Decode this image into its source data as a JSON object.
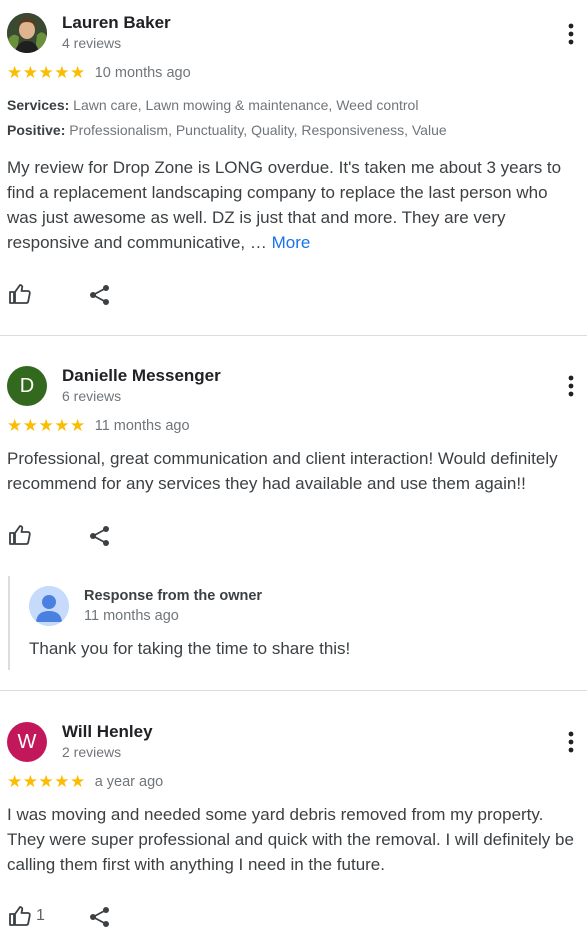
{
  "reviews": [
    {
      "name": "Lauren Baker",
      "reviews_count": "4 reviews",
      "stars": "★★★★★",
      "time": "10 months ago",
      "services_label": "Services:",
      "services": "Lawn care, Lawn mowing & maintenance, Weed control",
      "positive_label": "Positive:",
      "positive": "Professionalism, Punctuality, Quality, Responsiveness, Value",
      "text": "My review for Drop Zone is LONG overdue. It's taken me about 3 years to find a replacement landscaping company to replace the last person who was just awesome as well. DZ is just that and more. They are very responsive and communicative, …",
      "more_label": "More"
    },
    {
      "name": "Danielle Messenger",
      "avatar_letter": "D",
      "avatar_color": "#33691e",
      "reviews_count": "6 reviews",
      "stars": "★★★★★",
      "time": "11 months ago",
      "text": "Professional, great communication and client interaction! Would definitely recommend for any services they had available and use them again!!",
      "owner_response": {
        "title": "Response from the owner",
        "time": "11 months ago",
        "text": "Thank you for taking the time to share this!"
      }
    },
    {
      "name": "Will Henley",
      "avatar_letter": "W",
      "avatar_color": "#c2185b",
      "reviews_count": "2 reviews",
      "stars": "★★★★★",
      "time": "a year ago",
      "text": "I was moving and needed some yard debris removed from my property. They were super professional and quick with the removal. I will definitely be calling them first with anything I need in the future.",
      "likes": "1"
    }
  ],
  "colors": {
    "star": "#fbbc04",
    "link": "#1a73e8",
    "divider": "#dadce0"
  },
  "icons": [
    "thumb-up-icon",
    "share-icon",
    "more-vert-icon"
  ]
}
